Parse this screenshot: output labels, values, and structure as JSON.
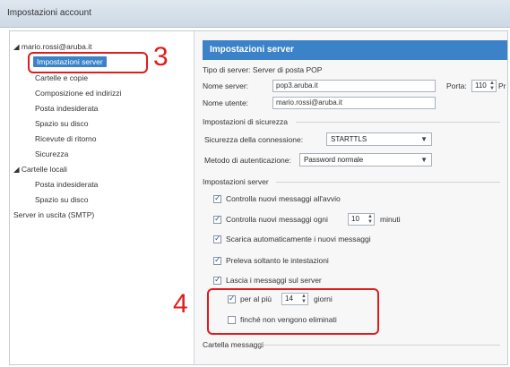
{
  "window": {
    "title": "Impostazioni account"
  },
  "sidebar": {
    "account": "mario.rossi@aruba.it",
    "items": [
      {
        "label": "Impostazioni server",
        "selected": true
      },
      {
        "label": "Cartelle e copie"
      },
      {
        "label": "Composizione ed indirizzi"
      },
      {
        "label": "Posta indesiderata"
      },
      {
        "label": "Spazio su disco"
      },
      {
        "label": "Ricevute di ritorno"
      },
      {
        "label": "Sicurezza"
      }
    ],
    "local_folders": "Cartelle locali",
    "local_items": [
      {
        "label": "Posta indesiderata"
      },
      {
        "label": "Spazio su disco"
      }
    ],
    "smtp": "Server in uscita (SMTP)"
  },
  "annotations": {
    "step3": "3",
    "step4": "4",
    "color": "#e01c1c"
  },
  "main": {
    "header": "Impostazioni server",
    "server_type_label": "Tipo di server:",
    "server_type_value": "Server di posta POP",
    "server_name_label": "Nome server:",
    "server_name_value": "pop3.aruba.it",
    "port_label": "Porta:",
    "port_value": "110",
    "port_default": "Pr",
    "username_label": "Nome utente:",
    "username_value": "mario.rossi@aruba.it",
    "security_title": "Impostazioni di sicurezza",
    "conn_security_label": "Sicurezza della connessione:",
    "conn_security_value": "STARTTLS",
    "auth_method_label": "Metodo di autenticazione:",
    "auth_method_value": "Password normale",
    "server_settings_title": "Impostazioni server",
    "options": [
      {
        "label": "Controlla nuovi messaggi all'avvio",
        "checked": true
      },
      {
        "label": "Controlla nuovi messaggi ogni",
        "checked": true,
        "value": "10",
        "suffix": "minuti"
      },
      {
        "label": "Scarica automaticamente i nuovi messaggi",
        "checked": true
      },
      {
        "label": "Preleva soltanto le intestazioni",
        "checked": true
      },
      {
        "label": "Lascia i messaggi sul server",
        "checked": true
      },
      {
        "label": "per al più",
        "checked": true,
        "value": "14",
        "suffix": "giorni"
      },
      {
        "label": "finché non vengono eliminati",
        "checked": false
      }
    ],
    "message_storage": "Cartella messaggi"
  }
}
